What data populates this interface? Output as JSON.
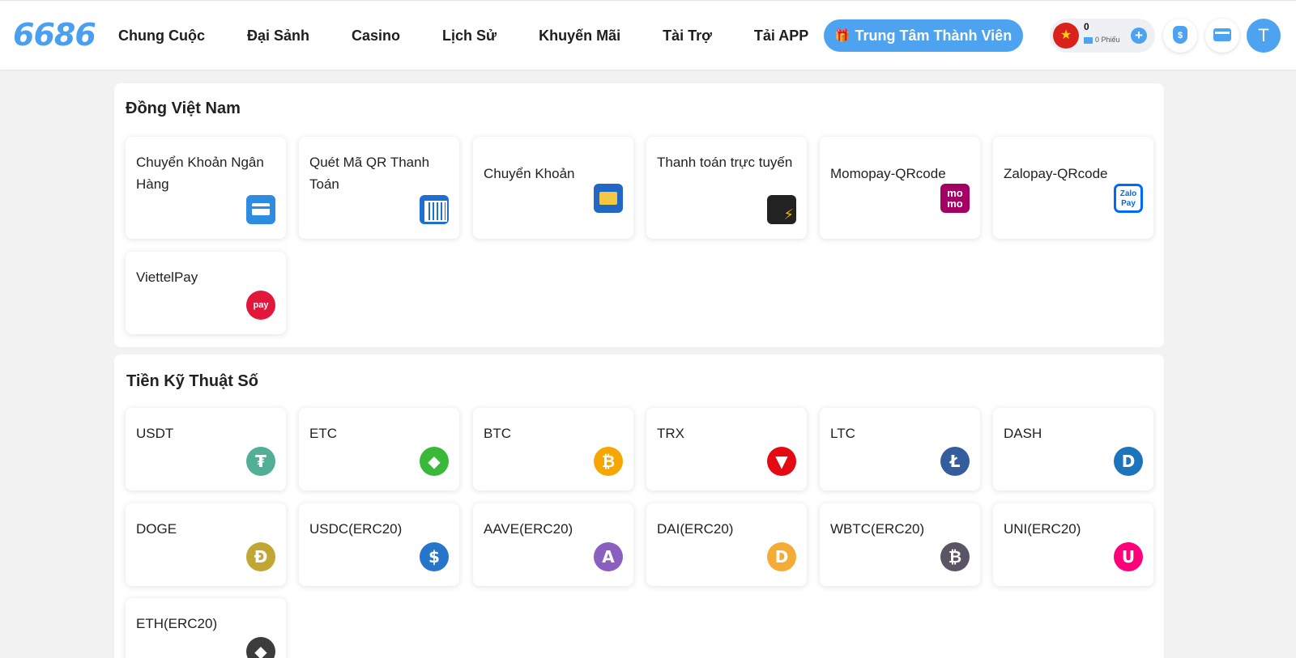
{
  "header": {
    "logo": "6686",
    "nav": [
      "Chung Cuộc",
      "Đại Sảnh",
      "Casino",
      "Lịch Sử",
      "Khuyến Mãi",
      "Tài Trợ",
      "Tải APP"
    ],
    "member_center": "Trung Tâm Thành Viên",
    "balance": "0",
    "tickets": "0 Phiếu",
    "avatar_letter": "T"
  },
  "vnd": {
    "title": "Đồng Việt Nam",
    "methods": [
      {
        "label": "Chuyển Khoản Ngân Hàng",
        "icon": "bank-card-icon"
      },
      {
        "label": "Quét Mã QR Thanh Toán",
        "icon": "qr-code-icon"
      },
      {
        "label": "Chuyển Khoản",
        "icon": "transfer-icon"
      },
      {
        "label": "Thanh toán trực tuyến",
        "icon": "online-payment-icon"
      },
      {
        "label": "Momopay-QRcode",
        "icon": "momo-icon"
      },
      {
        "label": "Zalopay-QRcode",
        "icon": "zalopay-icon"
      },
      {
        "label": "ViettelPay",
        "icon": "viettelpay-icon"
      }
    ],
    "momo_text": "mo mo",
    "zalo_text": "Zalo Pay",
    "viettel_text": "pay"
  },
  "crypto": {
    "title": "Tiền Kỹ Thuật Số",
    "coins": [
      {
        "label": "USDT",
        "icon": "usdt-icon",
        "color": "#50af95",
        "glyph": "₮"
      },
      {
        "label": "ETC",
        "icon": "etc-icon",
        "color": "#3ab83a",
        "glyph": "◆"
      },
      {
        "label": "BTC",
        "icon": "btc-icon",
        "color": "#f7a600",
        "glyph": "₿"
      },
      {
        "label": "TRX",
        "icon": "trx-icon",
        "color": "#e50914",
        "glyph": "▼"
      },
      {
        "label": "LTC",
        "icon": "ltc-icon",
        "color": "#345d9d",
        "glyph": "Ł"
      },
      {
        "label": "DASH",
        "icon": "dash-icon",
        "color": "#1c75bc",
        "glyph": "D"
      },
      {
        "label": "DOGE",
        "icon": "doge-icon",
        "color": "#c2a633",
        "glyph": "Ð"
      },
      {
        "label": "USDC(ERC20)",
        "icon": "usdc-icon",
        "color": "#2775ca",
        "glyph": "$"
      },
      {
        "label": "AAVE(ERC20)",
        "icon": "aave-icon",
        "color": "#8b5fbf",
        "glyph": "A"
      },
      {
        "label": "DAI(ERC20)",
        "icon": "dai-icon",
        "color": "#f5ac37",
        "glyph": "D"
      },
      {
        "label": "WBTC(ERC20)",
        "icon": "wbtc-icon",
        "color": "#5a5564",
        "glyph": "₿"
      },
      {
        "label": "UNI(ERC20)",
        "icon": "uni-icon",
        "color": "#ff007a",
        "glyph": "U"
      },
      {
        "label": "ETH(ERC20)",
        "icon": "eth-icon",
        "color": "#3c3c3d",
        "glyph": "◆"
      }
    ]
  }
}
